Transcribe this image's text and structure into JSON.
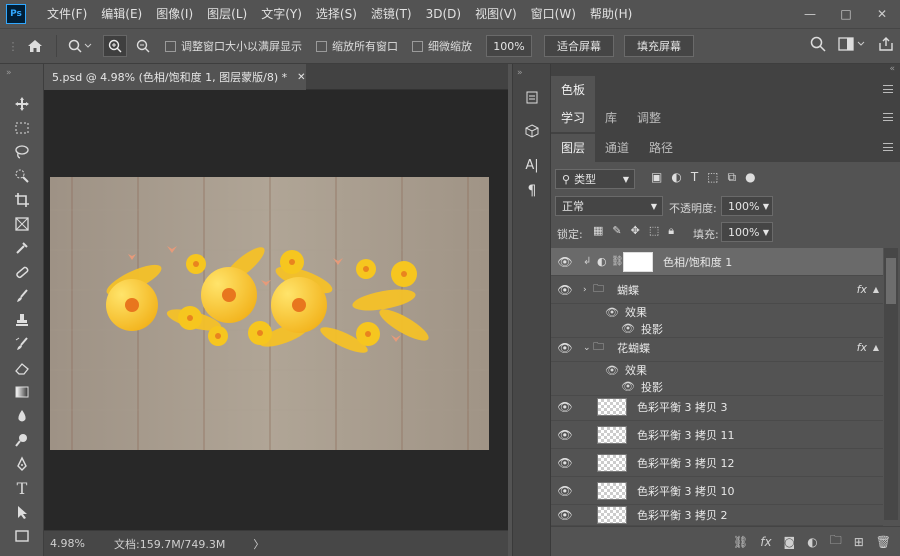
{
  "app": {
    "logo": "Ps"
  },
  "menu": [
    "文件(F)",
    "编辑(E)",
    "图像(I)",
    "图层(L)",
    "文字(Y)",
    "选择(S)",
    "滤镜(T)",
    "3D(D)",
    "视图(V)",
    "窗口(W)",
    "帮助(H)"
  ],
  "window_controls": {
    "minimize": "—",
    "maximize": "□",
    "close": "✕"
  },
  "options": {
    "resize_windows": "调整窗口大小以满屏显示",
    "zoom_all": "缩放所有窗口",
    "scrubby": "细微缩放",
    "zoom_value": "100%",
    "fit_screen": "适合屏幕",
    "fill_screen": "填充屏幕"
  },
  "document": {
    "tab_title": "5.psd @ 4.98% (色相/饱和度 1, 图层蒙版/8) *",
    "close": "✕",
    "zoom": "4.98%",
    "doc_info": "文档:159.7M/749.3M",
    "arrow": "〉"
  },
  "panel_color": {
    "tabs": [
      "色板"
    ]
  },
  "panel_learn": {
    "tabs": [
      "学习",
      "库",
      "调整"
    ]
  },
  "panel_layers": {
    "tabs": [
      "图层",
      "通道",
      "路径"
    ],
    "filter": "类型",
    "blend": "正常",
    "opacity_label": "不透明度:",
    "opacity": "100%",
    "lock_label": "锁定:",
    "fill_label": "填充:",
    "fill": "100%",
    "layers": [
      {
        "name": "色相/饱和度 1",
        "kind": "adjustment"
      },
      {
        "name": "蝴蝶",
        "kind": "group",
        "fx": "fx"
      },
      {
        "name": "效果",
        "kind": "effect"
      },
      {
        "name": "投影",
        "kind": "effect-item"
      },
      {
        "name": "花蝴蝶",
        "kind": "group",
        "fx": "fx"
      },
      {
        "name": "效果",
        "kind": "effect"
      },
      {
        "name": "投影",
        "kind": "effect-item"
      },
      {
        "name": "色彩平衡 3 拷贝 3",
        "kind": "layer"
      },
      {
        "name": "色彩平衡 3 拷贝 11",
        "kind": "layer"
      },
      {
        "name": "色彩平衡 3 拷贝 12",
        "kind": "layer"
      },
      {
        "name": "色彩平衡 3 拷贝 10",
        "kind": "layer"
      },
      {
        "name": "色彩平衡 3 拷贝 2",
        "kind": "layer"
      }
    ]
  },
  "strip_icons": [
    "history-icon",
    "3d-icon",
    "character-icon",
    "paragraph-icon"
  ],
  "tools": [
    "move",
    "marquee",
    "lasso",
    "quick-select",
    "crop",
    "frame",
    "eyedropper",
    "healing",
    "brush",
    "stamp",
    "history-brush",
    "eraser",
    "gradient",
    "blur",
    "dodge",
    "pen",
    "type",
    "path-select",
    "rectangle"
  ]
}
